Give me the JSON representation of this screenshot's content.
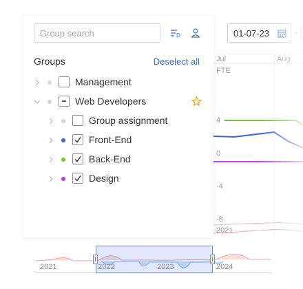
{
  "search": {
    "placeholder": "Group search",
    "value": ""
  },
  "groups": {
    "title": "Groups",
    "deselect_label": "Deselect all",
    "items": [
      {
        "label": "Management",
        "checked": false,
        "partial": false,
        "dot_color": "#d3d3d3"
      },
      {
        "label": "Web Developers",
        "checked": false,
        "partial": true,
        "dot_color": "#d3d3d3",
        "starred": true
      },
      {
        "label": "Group assignment",
        "checked": false,
        "partial": false,
        "dot_color": "#d3d3d3"
      },
      {
        "label": "Front-End",
        "checked": true,
        "partial": false,
        "dot_color": "#3b62e0"
      },
      {
        "label": "Back-End",
        "checked": true,
        "partial": false,
        "dot_color": "#6ccb2a"
      },
      {
        "label": "Design",
        "checked": true,
        "partial": false,
        "dot_color": "#b53cf0"
      }
    ]
  },
  "chart": {
    "date_from": "01-07-23",
    "date_separator": "-",
    "unit_label": "FTE",
    "months": [
      "Jul",
      "Aug"
    ],
    "y_ticks": [
      "4",
      "0",
      "-4",
      "-8"
    ],
    "year_label": "2021",
    "colors": {
      "front_end": "#3b62e0",
      "back_end": "#6ccb2a",
      "design": "#cc44ee"
    }
  },
  "navigator": {
    "years": [
      "2021",
      "2022",
      "2023",
      "2024"
    ]
  }
}
